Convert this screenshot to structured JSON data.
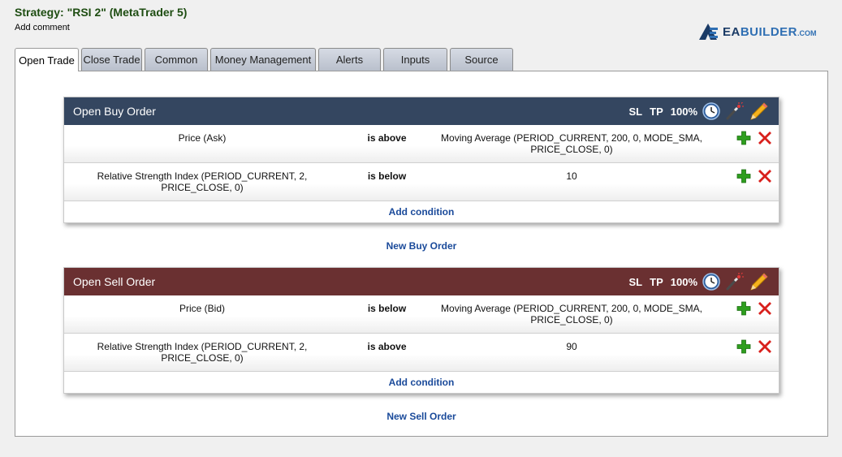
{
  "header": {
    "strategy_title": "Strategy: \"RSI 2\" (MetaTrader 5)",
    "add_comment": "Add comment"
  },
  "logo": {
    "name": "eabuilder-logo",
    "text_ea": "EA",
    "text_builder": "BUILDER",
    "text_com": ".COM"
  },
  "tabs": [
    {
      "label": "Open Trade",
      "active": true
    },
    {
      "label": "Close Trade",
      "active": false
    },
    {
      "label": "Common",
      "active": false
    },
    {
      "label": "Money Management",
      "active": false
    },
    {
      "label": "Alerts",
      "active": false
    },
    {
      "label": "Inputs",
      "active": false
    },
    {
      "label": "Source",
      "active": false
    }
  ],
  "buy_order": {
    "title": "Open Buy Order",
    "sl": "SL",
    "tp": "TP",
    "percent": "100%",
    "conditions": [
      {
        "left": "Price (Ask)",
        "operator": "is above",
        "right": "Moving Average (PERIOD_CURRENT, 200, 0, MODE_SMA, PRICE_CLOSE, 0)"
      },
      {
        "left": "Relative Strength Index (PERIOD_CURRENT, 2, PRICE_CLOSE, 0)",
        "operator": "is below",
        "right": "10"
      }
    ],
    "add_condition": "Add condition",
    "new_order": "New Buy Order"
  },
  "sell_order": {
    "title": "Open Sell Order",
    "sl": "SL",
    "tp": "TP",
    "percent": "100%",
    "conditions": [
      {
        "left": "Price (Bid)",
        "operator": "is below",
        "right": "Moving Average (PERIOD_CURRENT, 200, 0, MODE_SMA, PRICE_CLOSE, 0)"
      },
      {
        "left": "Relative Strength Index (PERIOD_CURRENT, 2, PRICE_CLOSE, 0)",
        "operator": "is above",
        "right": "90"
      }
    ],
    "add_condition": "Add condition",
    "new_order": "New Sell Order"
  },
  "icons": {
    "clock": "clock-icon",
    "magic_wand": "magic-wand-icon",
    "pencil": "pencil-icon",
    "add": "plus-icon",
    "remove": "close-icon"
  },
  "colors": {
    "buy_header": "#344660",
    "sell_header": "#6a3031",
    "title_green": "#1e4d12",
    "link_blue": "#1a4a9a",
    "add_green": "#2e9e1e",
    "remove_red": "#d8201c"
  }
}
